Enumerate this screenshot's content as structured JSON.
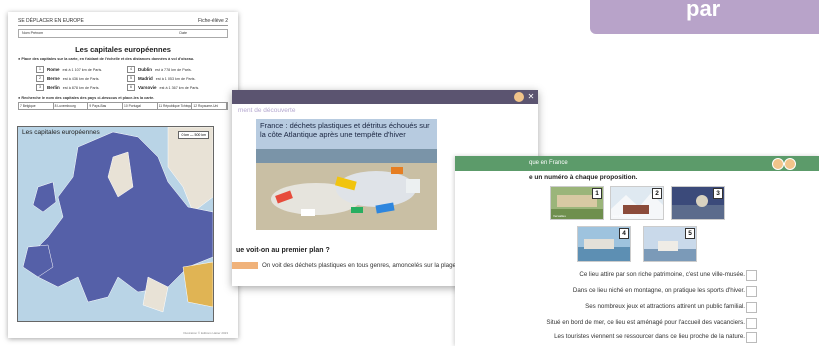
{
  "badge": {
    "text": "par"
  },
  "worksheet": {
    "header_left": "SE DÉPLACER EN EUROPE",
    "header_right": "Fiche-élève 2",
    "name_label": "Nom Prénom",
    "date_label": "Date",
    "title": "Les capitales européennes",
    "instruction1": "● Place des capitales sur la carte, en t'aidant de l'échelle et des distances données à vol d'oiseau.",
    "capitals": [
      {
        "num": "1",
        "city": "Rome",
        "detail": "est à 1 107 km de Paris."
      },
      {
        "num": "4",
        "city": "Dublin",
        "detail": "est à 778 km de Paris."
      },
      {
        "num": "2",
        "city": "Berne",
        "detail": "est à 436 km de Paris."
      },
      {
        "num": "5",
        "city": "Madrid",
        "detail": "est à 1 053 km de Paris."
      },
      {
        "num": "3",
        "city": "Berlin",
        "detail": "est à 878 km de Paris."
      },
      {
        "num": "6",
        "city": "Varsovie",
        "detail": "est à 1 367 km de Paris."
      }
    ],
    "instruction2": "● Recherche le nom des capitales des pays ci-dessous et place-les la carte.",
    "countries": [
      "7 Belgique",
      "8 Luxembourg",
      "9 Pays-Bas",
      "10 Portugal",
      "11 République Tchèque",
      "12 Royaume-Uni"
    ],
    "map_title": "Les capitales européennes",
    "map_scale": "0 km — 500 km",
    "credit": "Illustration © Editions Hatier 2023"
  },
  "dialog": {
    "subtitle": "ment de découverte",
    "caption": "France : déchets plastiques et détritus échoués sur la côte Atlantique après une tempête d'hiver",
    "question": "ue voit-on au premier plan ?",
    "answer": "On voit des déchets plastiques en tous genres, amoncelés sur la plage.",
    "next_glyph": "▶",
    "close_glyph": "✕"
  },
  "panel": {
    "title": "que en France",
    "instruction": "e un numéro à chaque proposition.",
    "thumbs": [
      {
        "num": "1",
        "label": "Versailles"
      },
      {
        "num": "2",
        "label": "Les 2 Alpes (Isère)"
      },
      {
        "num": "3",
        "label": ""
      },
      {
        "num": "4",
        "label": ""
      },
      {
        "num": "5",
        "label": ""
      }
    ],
    "propositions": [
      "Ce lieu attire par son riche patrimoine, c'est une ville-musée.",
      "Dans ce lieu niché en montagne, on pratique les sports d'hiver.",
      "Ses nombreux jeux et attractions attirent un public familial.",
      "Situé en bord de mer, ce lieu est aménagé pour l'accueil des vacanciers.",
      "Les touristes viennent se ressourcer dans ce lieu proche de la nature."
    ]
  },
  "colors": {
    "accent": "#b8a3c9",
    "dialog_bar": "#5b5470",
    "panel_bar": "#5c9b6a",
    "answer_tag": "#f0b27a"
  }
}
